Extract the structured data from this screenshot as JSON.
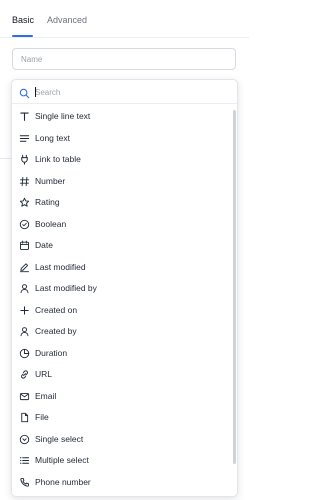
{
  "tabs": [
    {
      "label": "Basic",
      "active": true
    },
    {
      "label": "Advanced",
      "active": false
    }
  ],
  "name_field": {
    "placeholder": "Name"
  },
  "search": {
    "placeholder": "Search",
    "value": ""
  },
  "field_types": [
    {
      "label": "Single line text",
      "icon": "text-t-icon"
    },
    {
      "label": "Long text",
      "icon": "long-text-icon"
    },
    {
      "label": "Link to table",
      "icon": "link-plug-icon"
    },
    {
      "label": "Number",
      "icon": "hash-icon"
    },
    {
      "label": "Rating",
      "icon": "star-icon"
    },
    {
      "label": "Boolean",
      "icon": "check-circle-icon"
    },
    {
      "label": "Date",
      "icon": "calendar-icon"
    },
    {
      "label": "Last modified",
      "icon": "edit-pen-icon"
    },
    {
      "label": "Last modified by",
      "icon": "user-icon"
    },
    {
      "label": "Created on",
      "icon": "plus-icon"
    },
    {
      "label": "Created by",
      "icon": "user-icon"
    },
    {
      "label": "Duration",
      "icon": "pie-clock-icon"
    },
    {
      "label": "URL",
      "icon": "link-icon"
    },
    {
      "label": "Email",
      "icon": "mail-icon"
    },
    {
      "label": "File",
      "icon": "file-icon"
    },
    {
      "label": "Single select",
      "icon": "chevron-circle-icon"
    },
    {
      "label": "Multiple select",
      "icon": "list-icon"
    },
    {
      "label": "Phone number",
      "icon": "phone-icon"
    }
  ],
  "colors": {
    "accent": "#2f6feb",
    "border": "#e3e5e8",
    "text": "#1f2937",
    "muted": "#9ca3af"
  }
}
